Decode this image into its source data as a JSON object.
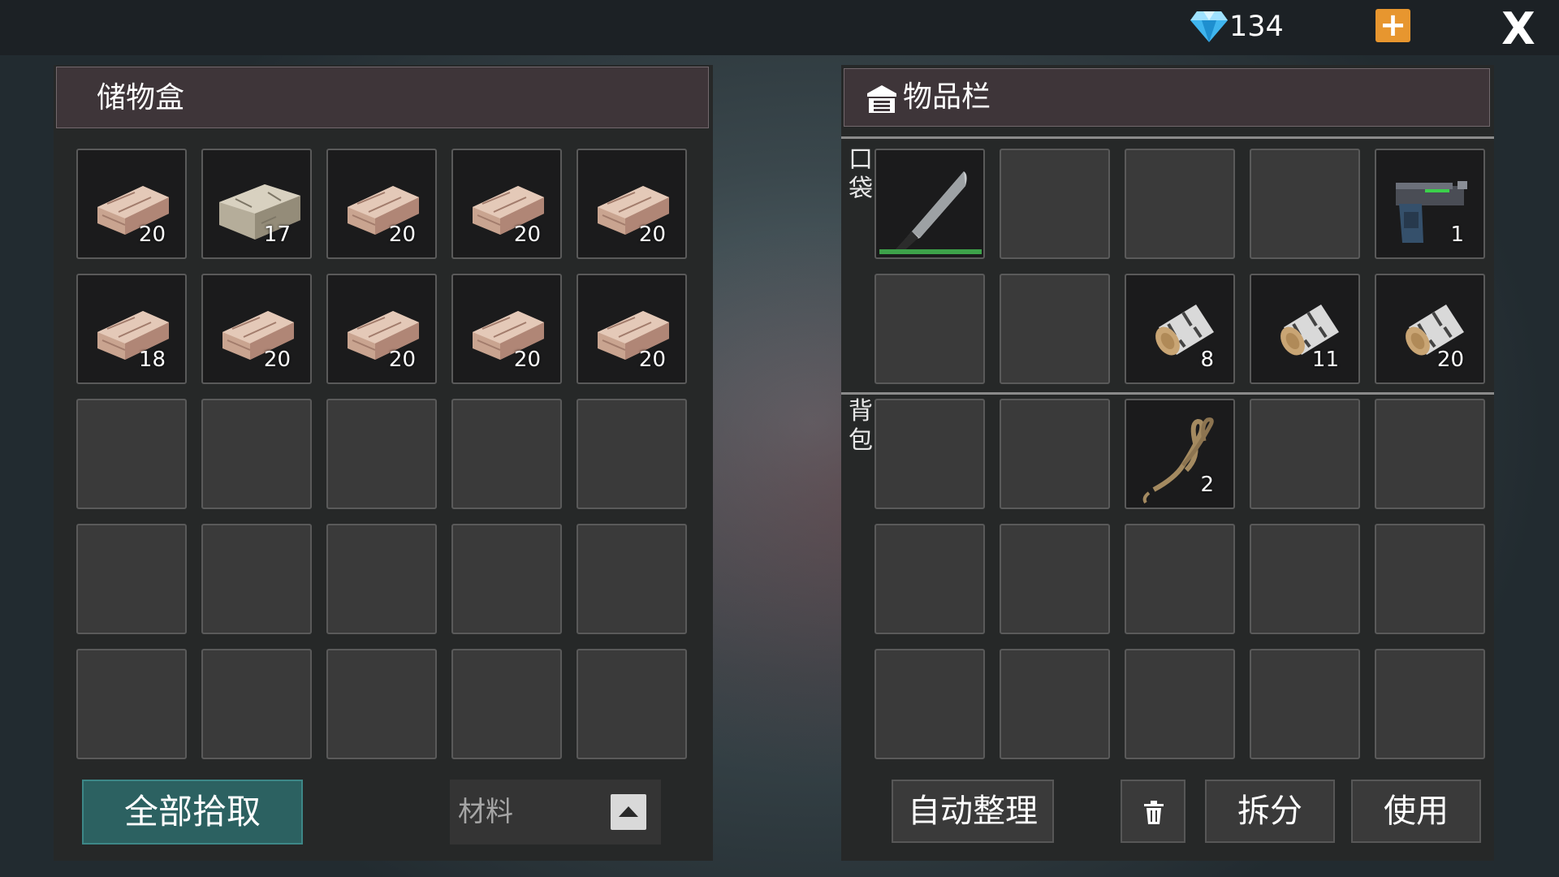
{
  "top_bar": {
    "gem_count": "134",
    "plus_label": "+",
    "close_label": "X"
  },
  "storage": {
    "title": "储物盒",
    "slots": [
      {
        "item": "brick",
        "qty": "20"
      },
      {
        "item": "stone-block",
        "qty": "17"
      },
      {
        "item": "brick",
        "qty": "20"
      },
      {
        "item": "brick",
        "qty": "20"
      },
      {
        "item": "brick",
        "qty": "20"
      },
      {
        "item": "brick",
        "qty": "18"
      },
      {
        "item": "brick",
        "qty": "20"
      },
      {
        "item": "brick",
        "qty": "20"
      },
      {
        "item": "brick",
        "qty": "20"
      },
      {
        "item": "brick",
        "qty": "20"
      },
      {},
      {},
      {},
      {},
      {},
      {},
      {},
      {},
      {},
      {},
      {},
      {},
      {},
      {},
      {}
    ],
    "collect_all_label": "全部拾取",
    "filter_label": "材料"
  },
  "inventory": {
    "title": "物品栏",
    "pocket_label_1": "口",
    "pocket_label_2": "袋",
    "backpack_label_1": "背",
    "backpack_label_2": "包",
    "pocket_slots": [
      {
        "item": "machete",
        "durability": 1.0
      },
      {},
      {},
      {},
      {
        "item": "pistol",
        "qty": "1"
      },
      {},
      {},
      {
        "item": "birch-log",
        "qty": "8"
      },
      {
        "item": "birch-log",
        "qty": "11"
      },
      {
        "item": "birch-log",
        "qty": "20"
      }
    ],
    "backpack_slots": [
      {},
      {},
      {
        "item": "rope",
        "qty": "2"
      },
      {},
      {},
      {},
      {},
      {},
      {},
      {},
      {},
      {},
      {},
      {},
      {}
    ],
    "auto_sort_label": "自动整理",
    "split_label": "拆分",
    "use_label": "使用"
  }
}
